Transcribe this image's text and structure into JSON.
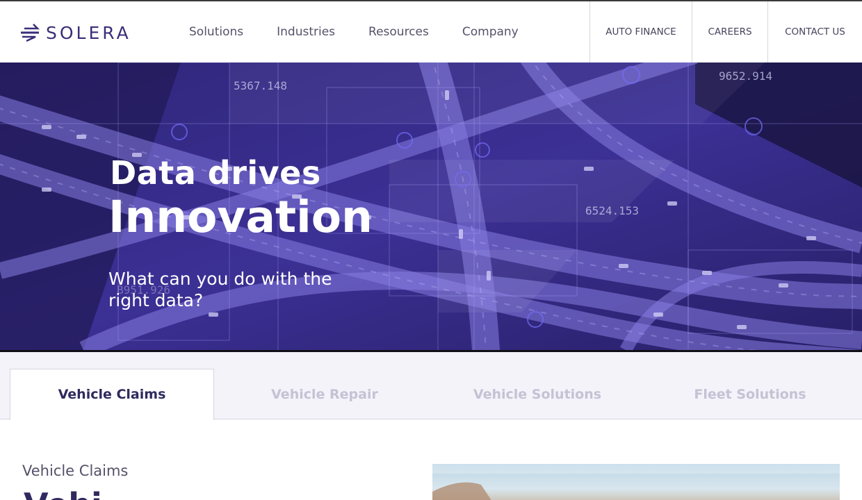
{
  "brand": {
    "name": "SOLERA",
    "color": "#3b2e78"
  },
  "nav": {
    "main": [
      "Solutions",
      "Industries",
      "Resources",
      "Company"
    ],
    "utility": [
      "AUTO FINANCE",
      "CAREERS",
      "CONTACT US"
    ]
  },
  "hero": {
    "title_line1": "Data drives",
    "title_line2": "Innovation",
    "subtitle": "What can you do with the right data?",
    "overlay_numbers": [
      "5367.148",
      "9652.914",
      "6524.153",
      "B951.926"
    ]
  },
  "tabs": {
    "items": [
      "Vehicle Claims",
      "Vehicle Repair",
      "Vehicle Solutions",
      "Fleet Solutions"
    ],
    "active": "Vehicle Claims"
  },
  "content": {
    "label": "Vehicle Claims",
    "heading": "Vehi"
  },
  "colors": {
    "accent": "#3b2e78",
    "hero_overlay": "#5a4bd6",
    "tab_inactive": "#c4c2d4"
  }
}
